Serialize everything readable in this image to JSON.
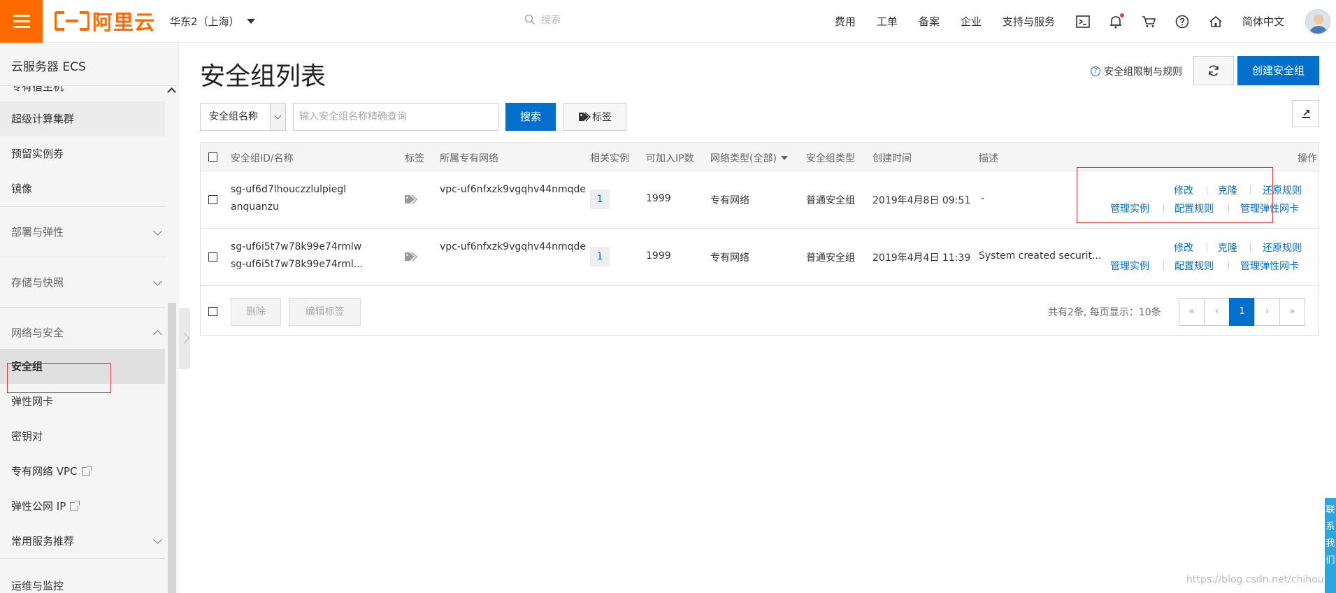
{
  "header": {
    "logo_text": "阿里云",
    "region": "华东2（上海）",
    "search_placeholder": "搜索",
    "nav": [
      "费用",
      "工单",
      "备案",
      "企业",
      "支持与服务"
    ],
    "language": "简体中文"
  },
  "sidebar": {
    "title": "云服务器 ECS",
    "cut_item": "专有宿主机",
    "items_top": [
      "超级计算集群",
      "预留实例券",
      "镜像"
    ],
    "groups": [
      "部署与弹性",
      "存储与快照",
      "网络与安全"
    ],
    "items_network": [
      "安全组",
      "弹性网卡",
      "密钥对",
      "专有网络 VPC",
      "弹性公网 IP"
    ],
    "recommend": "常用服务推荐",
    "bottom_cut": "运维与监控"
  },
  "page": {
    "title": "安全组列表",
    "limit_link": "安全组限制与规则",
    "create_button": "创建安全组"
  },
  "filter": {
    "select_value": "安全组名称",
    "input_placeholder": "输入安全组名称精确查询",
    "search_button": "搜索",
    "tag_button": "标签"
  },
  "table": {
    "headers": {
      "id_name": "安全组ID/名称",
      "tag": "标签",
      "vpc": "所属专有网络",
      "instances": "相关实例",
      "ip_count": "可加入IP数",
      "net_type": "网络类型(全部)",
      "sg_type": "安全组类型",
      "created": "创建时间",
      "desc": "描述",
      "ops": "操作"
    },
    "rows": [
      {
        "id": "sg-uf6d7lhouczzlulpiegl",
        "name": "anquanzu",
        "vpc": "vpc-uf6nfxzk9vgqhv44nmqde",
        "instances": "1",
        "ip_count": "1999",
        "net_type": "专有网络",
        "sg_type": "普通安全组",
        "created": "2019年4月8日 09:51",
        "desc": "-"
      },
      {
        "id": "sg-uf6i5t7w78k99e74rmlw",
        "name": "sg-uf6i5t7w78k99e74rml...",
        "vpc": "vpc-uf6nfxzk9vgqhv44nmqde",
        "instances": "1",
        "ip_count": "1999",
        "net_type": "专有网络",
        "sg_type": "普通安全组",
        "created": "2019年4月4日 11:39",
        "desc": "System created securit..."
      }
    ],
    "ops": {
      "modify": "修改",
      "clone": "克隆",
      "restore": "还原规则",
      "manage_instances": "管理实例",
      "configure_rules": "配置规则",
      "manage_eni": "管理弹性网卡"
    }
  },
  "footer": {
    "delete_button": "删除",
    "edit_tags_button": "编辑标签",
    "page_info": "共有2条, 每页显示：10条",
    "pager": [
      "«",
      "‹",
      "1",
      "›",
      "»"
    ]
  },
  "float_contact": "联系我们",
  "watermark": "https://blog.csdn.net/chihou",
  "colors": {
    "brand_orange": "#ff6a00",
    "primary_blue": "#0070cc",
    "highlight_red": "#e0363c"
  }
}
